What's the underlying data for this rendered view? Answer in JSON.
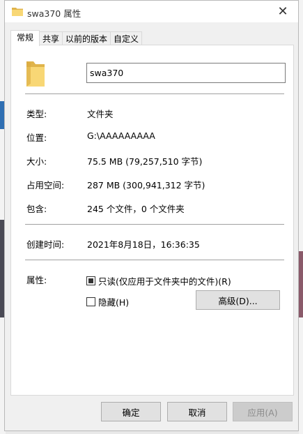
{
  "window": {
    "title": "swa370 属性",
    "close_symbol": "✕"
  },
  "tabs": [
    {
      "label": "常规",
      "active": true
    },
    {
      "label": "共享",
      "active": false
    },
    {
      "label": "以前的版本",
      "active": false
    },
    {
      "label": "自定义",
      "active": false
    }
  ],
  "general": {
    "folder_name": "swa370",
    "type": {
      "label": "类型:",
      "value": "文件夹"
    },
    "location": {
      "label": "位置:",
      "value": "G:\\AAAAAAAAA"
    },
    "size": {
      "label": "大小:",
      "value": "75.5 MB (79,257,510 字节)"
    },
    "size_on_disk": {
      "label": "占用空间:",
      "value": "287 MB (300,941,312 字节)"
    },
    "contains": {
      "label": "包含:",
      "value": "245 个文件，0 个文件夹"
    },
    "created": {
      "label": "创建时间:",
      "value": "2021年8月18日，16:36:35"
    },
    "attributes": {
      "label": "属性:",
      "readonly_label": "只读(仅应用于文件夹中的文件)(R)",
      "readonly_state": "indeterminate",
      "hidden_label": "隐藏(H)",
      "hidden_checked": false,
      "advanced_button": "高级(D)..."
    }
  },
  "buttons": {
    "ok": "确定",
    "cancel": "取消",
    "apply": "应用(A)"
  },
  "colors": {
    "folder_yellow": "#f8d775",
    "folder_dark": "#e0b44b",
    "panel_bg": "#ffffff",
    "window_bg": "#f0f0f0"
  }
}
